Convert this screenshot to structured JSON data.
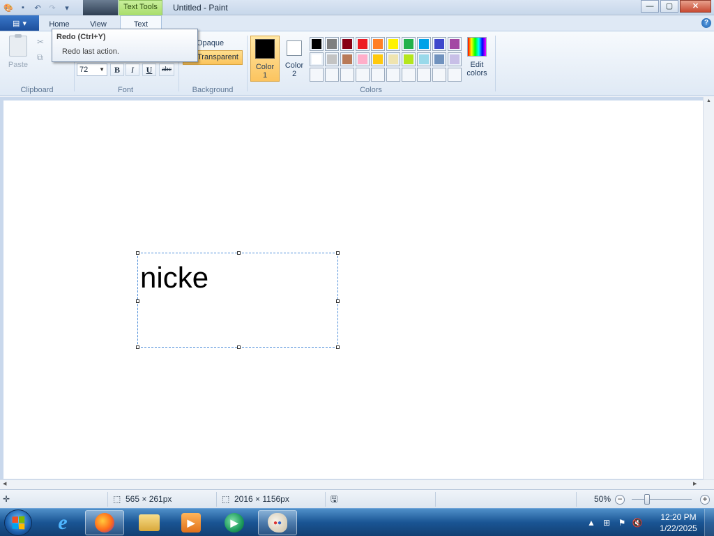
{
  "window": {
    "title": "Untitled - Paint",
    "context_tab": "Text Tools",
    "controls": {
      "minimize": "—",
      "maximize": "▢",
      "close": "✕"
    }
  },
  "quick_access": {
    "icons": [
      "paint-app-icon",
      "save-icon",
      "undo-icon",
      "redo-icon",
      "customize-qat-icon"
    ]
  },
  "tabs": [
    {
      "label": "Home"
    },
    {
      "label": "View"
    },
    {
      "label": "Text"
    }
  ],
  "ribbon": {
    "clipboard": {
      "paste": "Paste",
      "group": "Clipboard"
    },
    "font": {
      "size": "72",
      "bold": "B",
      "italic": "I",
      "underline": "U",
      "strikethrough": "abc",
      "group": "Font"
    },
    "background": {
      "opaque": "Opaque",
      "transparent": "Transparent",
      "group": "Background"
    },
    "colors": {
      "color1": [
        "Color",
        "1"
      ],
      "color2": [
        "Color",
        "2"
      ],
      "edit": [
        "Edit",
        "colors"
      ],
      "group": "Colors",
      "palette": [
        "#000000",
        "#7f7f7f",
        "#880015",
        "#ed1c24",
        "#ff7f27",
        "#fff200",
        "#22b14c",
        "#00a2e8",
        "#3f48cc",
        "#a349a4",
        "#ffffff",
        "#c3c3c3",
        "#b97a57",
        "#ffaec9",
        "#ffc90e",
        "#efe4b0",
        "#b5e61d",
        "#99d9ea",
        "#7092be",
        "#c8bfe7",
        "",
        "",
        "",
        "",
        "",
        "",
        "",
        "",
        "",
        ""
      ]
    }
  },
  "tooltip": {
    "title": "Redo (Ctrl+Y)",
    "description": "Redo last action."
  },
  "canvas": {
    "text": "nicke"
  },
  "status": {
    "selection_size": "565 × 261px",
    "image_size": "2016 × 1156px",
    "zoom": "50%"
  },
  "taskbar": {
    "apps": [
      "internet-explorer",
      "firefox",
      "file-explorer",
      "media-player",
      "media-center",
      "paint"
    ],
    "time": "12:20 PM",
    "date": "1/22/2025"
  }
}
